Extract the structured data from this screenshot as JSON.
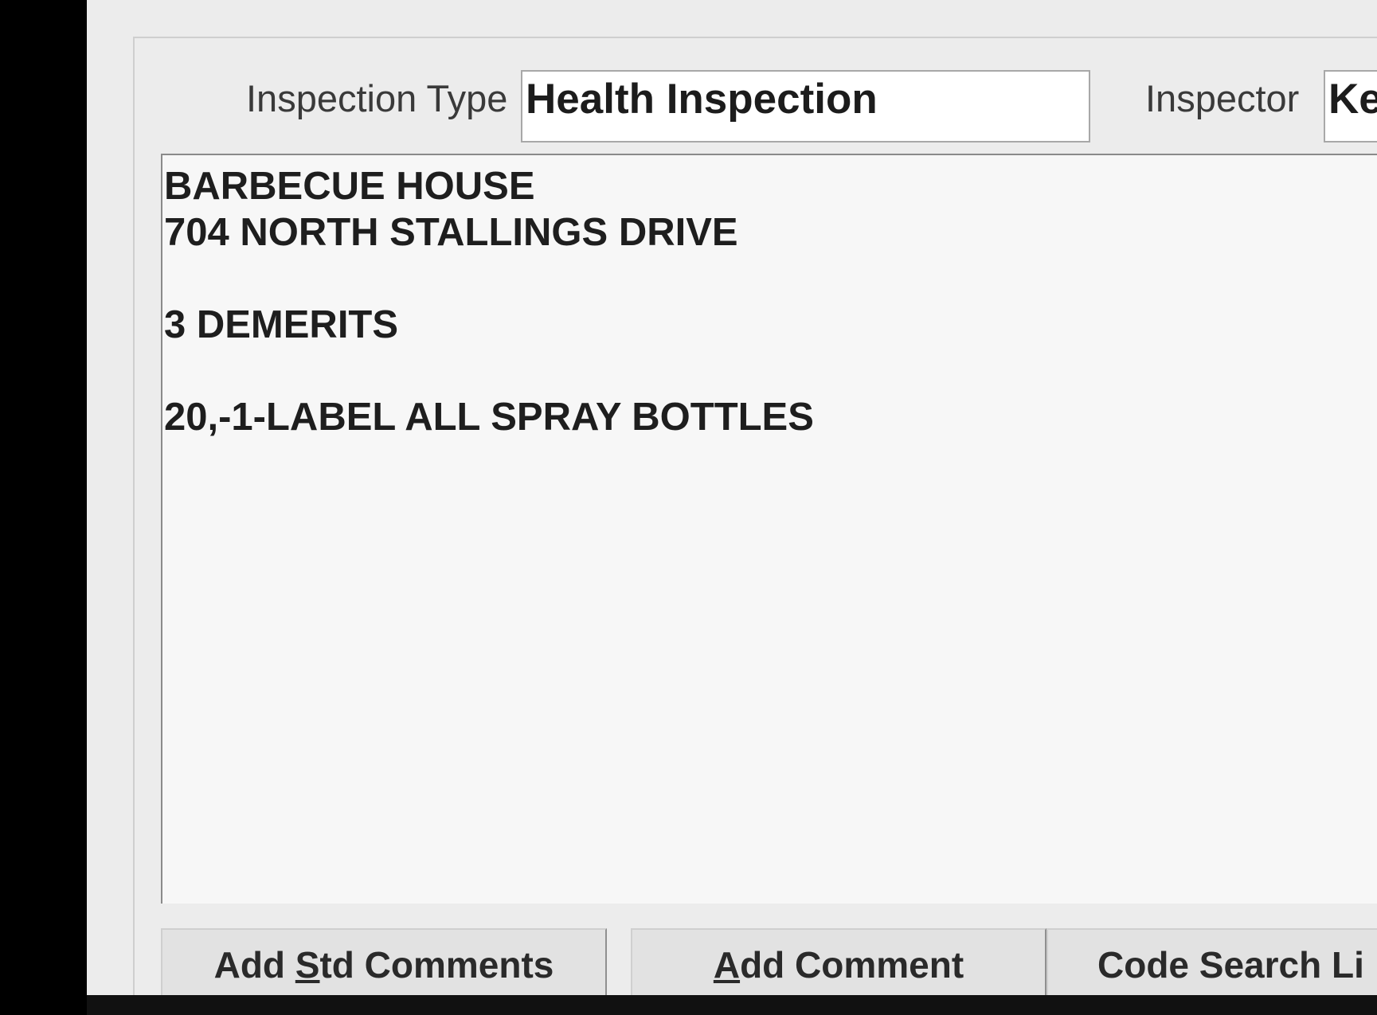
{
  "form": {
    "inspection_type_label": "Inspection Type",
    "inspection_type_value": "Health Inspection",
    "inspector_label": "Inspector",
    "inspector_value": "Ke"
  },
  "comments": {
    "lines": [
      "BARBECUE HOUSE",
      "704 NORTH STALLINGS DRIVE",
      "",
      "3 DEMERITS",
      "",
      "20,-1-LABEL ALL SPRAY BOTTLES"
    ]
  },
  "buttons": {
    "add_std_comments": {
      "pre": "Add ",
      "key": "S",
      "post": "td Comments"
    },
    "add_comment": {
      "pre": "",
      "key": "A",
      "post": "dd Comment"
    },
    "code_search": {
      "pre": "Code Search Li",
      "key": "",
      "post": ""
    }
  }
}
